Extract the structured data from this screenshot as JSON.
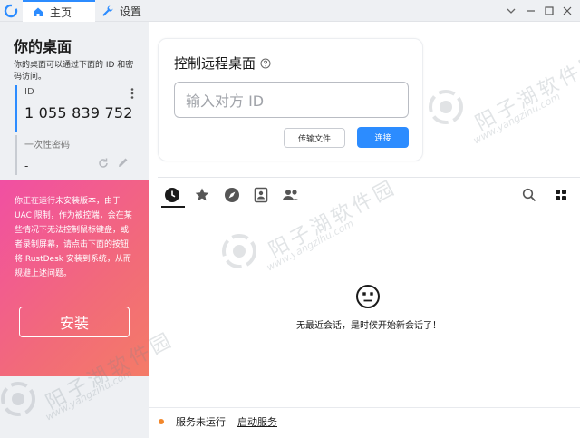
{
  "titlebar": {
    "tabs": [
      {
        "label": "主页",
        "icon": "home-icon"
      },
      {
        "label": "设置",
        "icon": "wrench-icon"
      }
    ]
  },
  "sidebar": {
    "title": "你的桌面",
    "description": "你的桌面可以通过下面的 ID 和密码访问。",
    "id_label": "ID",
    "id_value": "1 055 839 752",
    "otp_label": "一次性密码",
    "otp_value": "-",
    "warning_text": "你正在运行未安装版本，由于 UAC 限制，作为被控端，会在某些情况下无法控制鼠标键盘，或者录制屏幕，请点击下面的按钮将 RustDesk 安装到系统，从而规避上述问题。",
    "install_label": "安装"
  },
  "remote": {
    "title": "控制远程桌面",
    "input_placeholder": "输入对方 ID",
    "transfer_label": "传输文件",
    "connect_label": "连接"
  },
  "peers": {
    "tabs": [
      "recent-icon",
      "star-icon",
      "compass-icon",
      "address-book-icon",
      "group-icon"
    ],
    "empty_text": "无最近会话，是时候开始新会话了！"
  },
  "status": {
    "text": "服务未运行",
    "link": "启动服务"
  },
  "watermark": {
    "text": "阳子湖软件园",
    "url": "www.yangzihu.com"
  },
  "colors": {
    "accent": "#2c8cff",
    "warning_gradient_start": "#f14fa3",
    "warning_gradient_end": "#f47b67",
    "status_dot": "#f2872b"
  }
}
